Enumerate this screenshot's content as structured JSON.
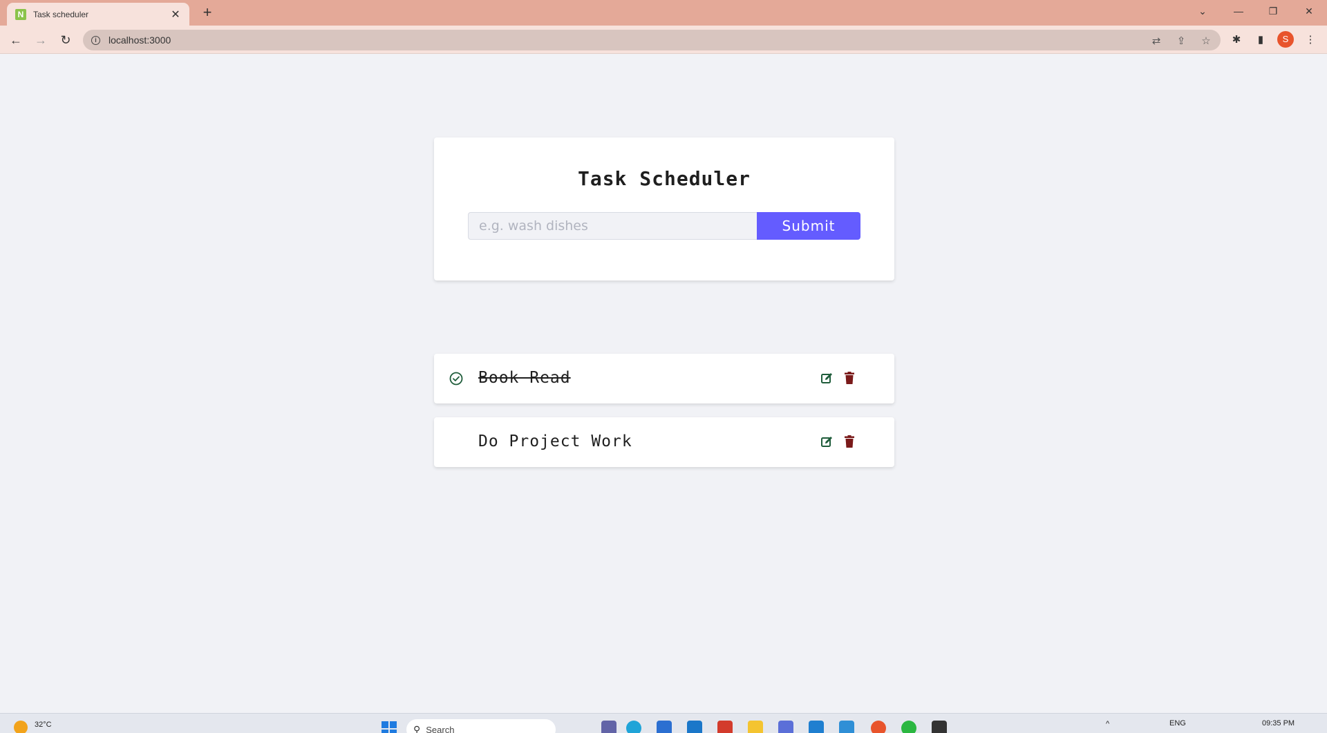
{
  "browser": {
    "tab_title": "Task scheduler",
    "favicon_letter": "N",
    "url": "localhost:3000",
    "new_tab": "+",
    "close_tab": "✕",
    "profile_initial": "S"
  },
  "app": {
    "title": "Task Scheduler",
    "input_placeholder": "e.g. wash dishes",
    "input_value": "",
    "submit_label": "Submit"
  },
  "tasks": [
    {
      "text": "Book Read",
      "completed": true
    },
    {
      "text": "Do Project Work",
      "completed": false
    }
  ],
  "colors": {
    "accent": "#645cff",
    "edit_icon": "#1e5c3a",
    "delete_icon": "#7a1a1a",
    "check_icon": "#1e5c3a"
  },
  "taskbar": {
    "weather_temp": "32°C",
    "search_label": "Search",
    "language": "ENG",
    "time": "09:35 PM"
  }
}
